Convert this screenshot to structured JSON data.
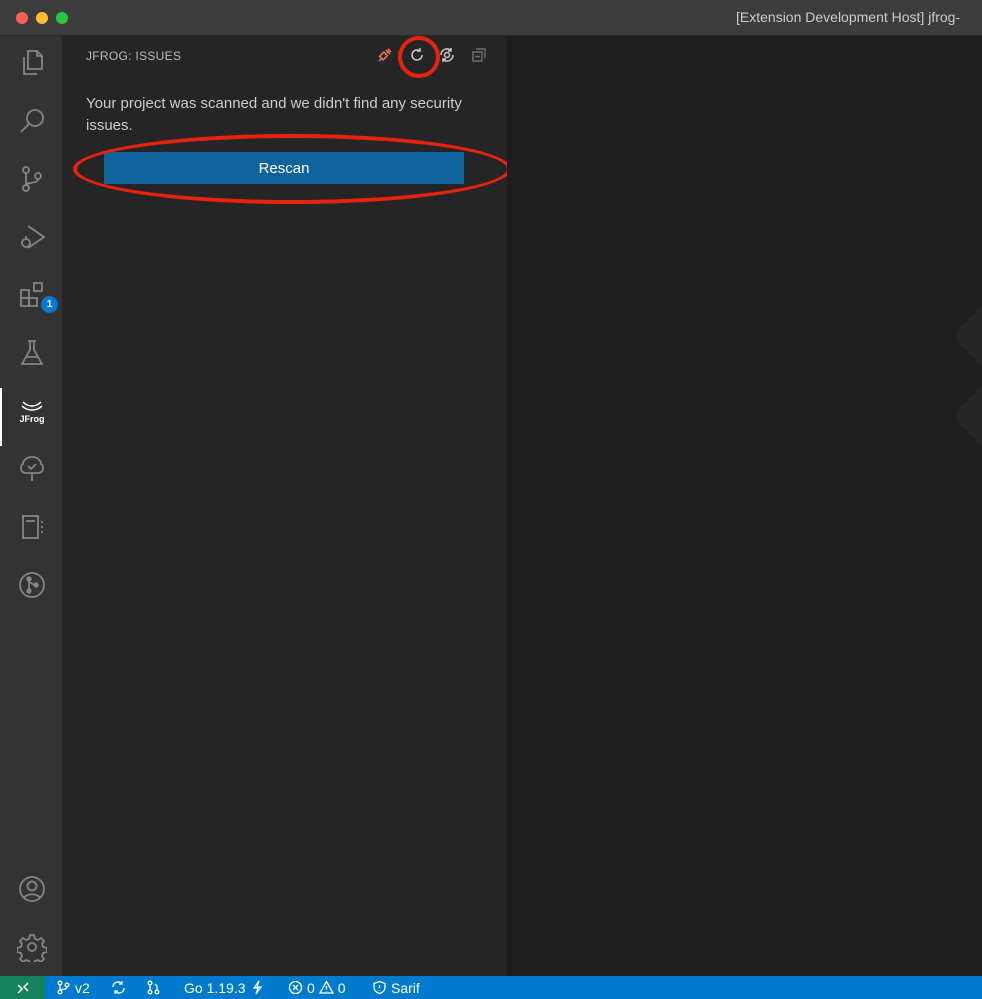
{
  "window": {
    "title": "[Extension Development Host] jfrog-"
  },
  "activity_bar": {
    "items": [
      {
        "name": "explorer-icon"
      },
      {
        "name": "search-icon"
      },
      {
        "name": "source-control-icon"
      },
      {
        "name": "run-debug-icon"
      },
      {
        "name": "extensions-icon",
        "badge": "1"
      },
      {
        "name": "testing-icon"
      },
      {
        "name": "jfrog-icon",
        "active": true
      },
      {
        "name": "tree-check-icon"
      },
      {
        "name": "notebook-icon"
      },
      {
        "name": "git-graph-icon"
      }
    ],
    "bottom_items": [
      {
        "name": "account-icon"
      },
      {
        "name": "settings-gear-icon"
      }
    ]
  },
  "sidebar": {
    "title": "JFROG: ISSUES",
    "actions": [
      {
        "name": "connect-icon",
        "color": "#e8795c"
      },
      {
        "name": "refresh-icon"
      },
      {
        "name": "scan-settings-icon"
      },
      {
        "name": "collapse-all-icon"
      }
    ],
    "message": "Your project was scanned and we didn't find any security issues.",
    "rescan_label": "Rescan"
  },
  "status_bar": {
    "branch": "v2",
    "go_version": "Go 1.19.3",
    "errors": "0",
    "warnings": "0",
    "sarif": "Sarif"
  },
  "colors": {
    "accent": "#007acc",
    "button": "#0e639c",
    "annotation": "#e8220c",
    "remote": "#16825d"
  }
}
